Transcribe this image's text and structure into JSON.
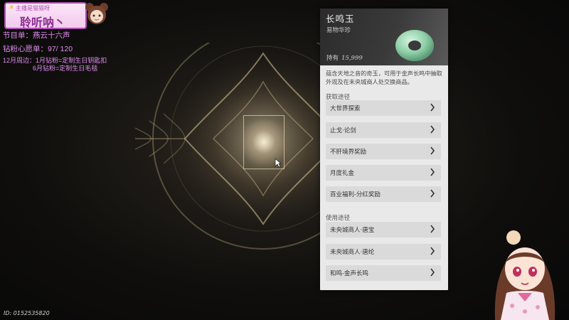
{
  "streamer": {
    "top_text": "主播是猫猫呀",
    "name": "聆听呐丶",
    "lines": [
      "节目单：燕云十六声",
      "钻粉心愿单：97/ 120",
      "12月周边：1月钻粉=定制生日钥匙扣",
      "6月钻粉=定制生日毛毯"
    ],
    "uid": "ID: 0152535820"
  },
  "item": {
    "name": "长鸣玉",
    "category": "易物华珍",
    "owned_label": "持有",
    "owned_value": "15,999",
    "description": "蕴含天地之音的奇玉，可用于金声长鸣中抽取外观及在未央城商人处交换商品。"
  },
  "acquire": {
    "label": "获取途径",
    "items": [
      "大世界探索",
      "止戈·论剑",
      "不肝境界奖励",
      "月度礼金",
      "百业福利-分红奖励"
    ]
  },
  "use": {
    "label": "使用途径",
    "items": [
      "未央城商人·唐宝",
      "未央城商人·唐纶",
      "和鸣-金声长鸣"
    ]
  },
  "colors": {
    "overlay_text": "#e08cf0",
    "panel_bg": "#e9e9e9",
    "jade": "#8fd0a8"
  },
  "icons": {
    "row_arrow": "chevron-right-icon",
    "cursor": "mouse-cursor-icon"
  }
}
